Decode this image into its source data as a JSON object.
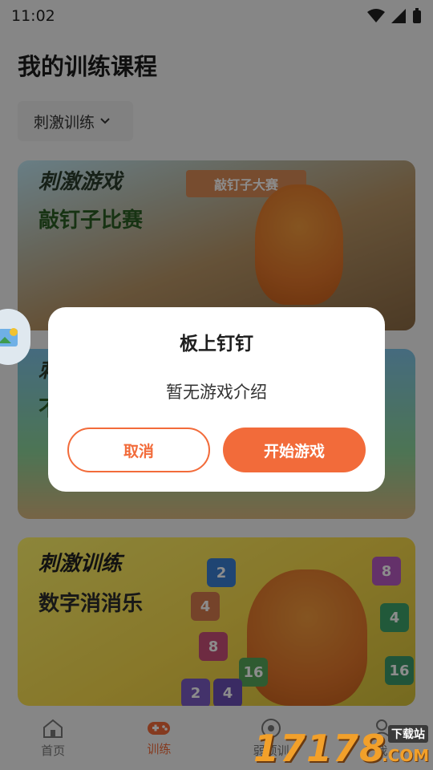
{
  "status_bar": {
    "time": "11:02"
  },
  "page_title": "我的训练课程",
  "category_select": {
    "value": "刺激训练"
  },
  "cards": [
    {
      "tag": "刺激游戏",
      "title": "敲钉子比赛",
      "banner": "敲钉子大赛"
    },
    {
      "tag": "刺",
      "title": "不"
    },
    {
      "tag": "刺激训练",
      "title": "数字消消乐",
      "tiles": [
        "2",
        "4",
        "8",
        "8",
        "4",
        "16",
        "16",
        "2",
        "4"
      ]
    }
  ],
  "dialog": {
    "title": "板上钉钉",
    "message": "暂无游戏介绍",
    "cancel_label": "取消",
    "start_label": "开始游戏"
  },
  "tabbar": {
    "items": [
      {
        "label": "首页",
        "icon": "home-icon"
      },
      {
        "label": "训练",
        "icon": "gamepad-icon"
      },
      {
        "label": "弱项训",
        "icon": "target-icon"
      },
      {
        "label": "我",
        "icon": "user-icon"
      }
    ]
  },
  "watermark": {
    "number": "17178",
    "site": "下载站",
    "domain": ".COM"
  },
  "colors": {
    "accent": "#f26b3a",
    "overlay": "rgba(0,0,0,0.45)"
  }
}
